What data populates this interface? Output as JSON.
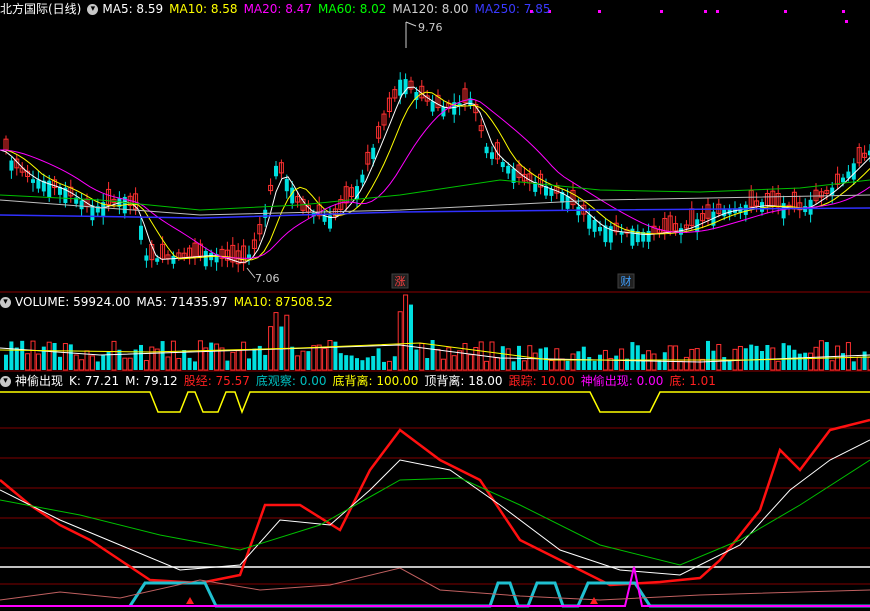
{
  "header": {
    "stock_name": "北方国际(日线)",
    "ma": [
      {
        "label": "MA5: 8.59",
        "color": "#ffffff"
      },
      {
        "label": "MA10: 8.58",
        "color": "#ffff00"
      },
      {
        "label": "MA20: 8.47",
        "color": "#ff00ff"
      },
      {
        "label": "MA60: 8.02",
        "color": "#00ff00"
      },
      {
        "label": "MA120: 8.00",
        "color": "#d0d0d0"
      },
      {
        "label": "MA250: 7.85",
        "color": "#3a3aff"
      }
    ]
  },
  "volume_header": [
    {
      "label": "VOLUME: 59924.00",
      "color": "#ffffff"
    },
    {
      "label": "MA5: 71435.97",
      "color": "#ffffff"
    },
    {
      "label": "MA10: 87508.52",
      "color": "#ffff00"
    }
  ],
  "indicator_header": [
    {
      "label": "神偷出现",
      "color": "#ffffff"
    },
    {
      "label": "K: 77.21",
      "color": "#ffffff"
    },
    {
      "label": "M: 79.12",
      "color": "#ffffff"
    },
    {
      "label": "股经: 75.57",
      "color": "#ff2020"
    },
    {
      "label": "底观察: 0.00",
      "color": "#00c0c0"
    },
    {
      "label": "底背离: 100.00",
      "color": "#ffff00"
    },
    {
      "label": "顶背离: 18.00",
      "color": "#ffffff"
    },
    {
      "label": "跟踪: 10.00",
      "color": "#ff2020"
    },
    {
      "label": "神偷出现: 0.00",
      "color": "#ff00ff"
    },
    {
      "label": "底: 1.01",
      "color": "#ff2020"
    }
  ],
  "chart_data": {
    "type": "candlestick",
    "high_label": "9.76",
    "low_label": "7.06",
    "event_labels": [
      {
        "text": "涨",
        "color": "#ff4040"
      },
      {
        "text": "财",
        "color": "#40a0ff"
      }
    ],
    "colors": {
      "up": "#ff3030",
      "down": "#00e0e0"
    }
  }
}
